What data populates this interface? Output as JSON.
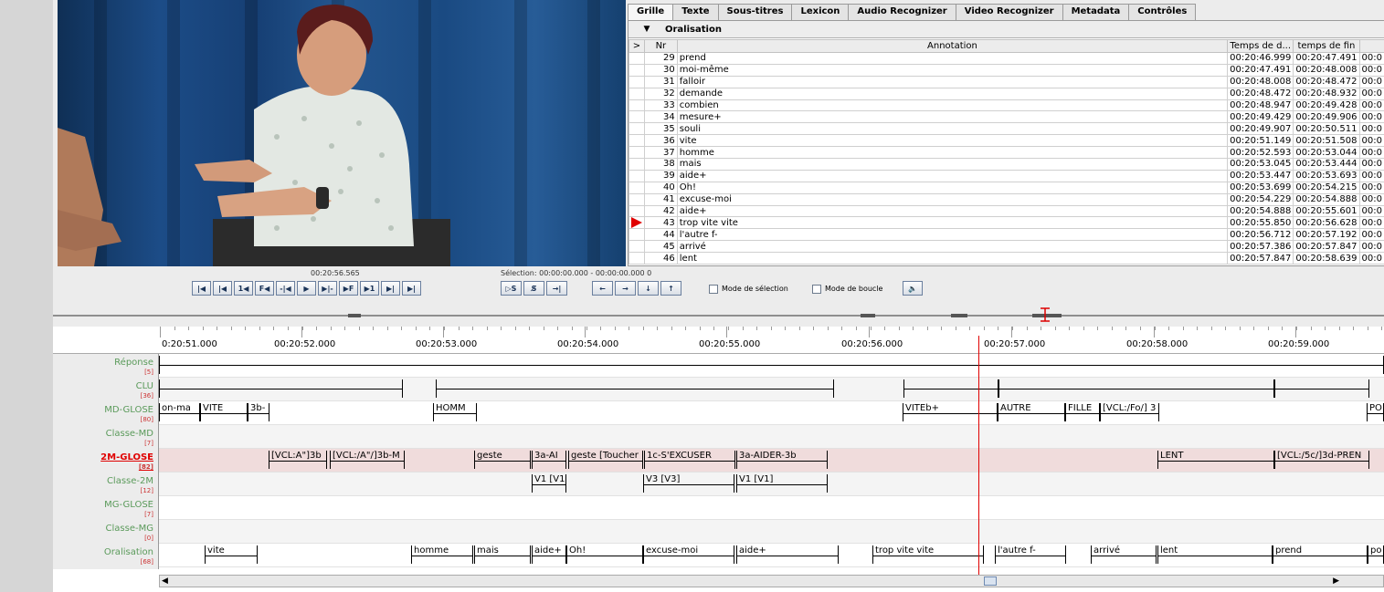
{
  "tabs": [
    "Grille",
    "Texte",
    "Sous-titres",
    "Lexicon",
    "Audio Recognizer",
    "Video Recognizer",
    "Metadata",
    "Contrôles"
  ],
  "grid": {
    "tier_dropdown": "▼",
    "tier_name": "Oralisation",
    "headers": {
      "mark": ">",
      "nr": "Nr",
      "annotation": "Annotation",
      "begin": "Temps de d...",
      "end": "temps de fin",
      "extra": ""
    },
    "rows": [
      {
        "nr": "29",
        "ann": "prend",
        "begin": "00:20:46.999",
        "end": "00:20:47.491",
        "extra": "00:0"
      },
      {
        "nr": "30",
        "ann": "moi-même",
        "begin": "00:20:47.491",
        "end": "00:20:48.008",
        "extra": "00:0"
      },
      {
        "nr": "31",
        "ann": "falloir",
        "begin": "00:20:48.008",
        "end": "00:20:48.472",
        "extra": "00:0"
      },
      {
        "nr": "32",
        "ann": "demande",
        "begin": "00:20:48.472",
        "end": "00:20:48.932",
        "extra": "00:0"
      },
      {
        "nr": "33",
        "ann": "combien",
        "begin": "00:20:48.947",
        "end": "00:20:49.428",
        "extra": "00:0"
      },
      {
        "nr": "34",
        "ann": "mesure+",
        "begin": "00:20:49.429",
        "end": "00:20:49.906",
        "extra": "00:0"
      },
      {
        "nr": "35",
        "ann": "souli",
        "begin": "00:20:49.907",
        "end": "00:20:50.511",
        "extra": "00:0"
      },
      {
        "nr": "36",
        "ann": "vite",
        "begin": "00:20:51.149",
        "end": "00:20:51.508",
        "extra": "00:0"
      },
      {
        "nr": "37",
        "ann": "homme",
        "begin": "00:20:52.593",
        "end": "00:20:53.044",
        "extra": "00:0"
      },
      {
        "nr": "38",
        "ann": "mais",
        "begin": "00:20:53.045",
        "end": "00:20:53.444",
        "extra": "00:0"
      },
      {
        "nr": "39",
        "ann": "aide+",
        "begin": "00:20:53.447",
        "end": "00:20:53.693",
        "extra": "00:0"
      },
      {
        "nr": "40",
        "ann": "Oh!",
        "begin": "00:20:53.699",
        "end": "00:20:54.215",
        "extra": "00:0"
      },
      {
        "nr": "41",
        "ann": "excuse-moi",
        "begin": "00:20:54.229",
        "end": "00:20:54.888",
        "extra": "00:0"
      },
      {
        "nr": "42",
        "ann": "aide+",
        "begin": "00:20:54.888",
        "end": "00:20:55.601",
        "extra": "00:0"
      },
      {
        "nr": "43",
        "ann": "trop vite vite",
        "begin": "00:20:55.850",
        "end": "00:20:56.628",
        "extra": "00:0"
      },
      {
        "nr": "44",
        "ann": "l'autre f-",
        "begin": "00:20:56.712",
        "end": "00:20:57.192",
        "extra": "00:0"
      },
      {
        "nr": "45",
        "ann": "arrivé",
        "begin": "00:20:57.386",
        "end": "00:20:57.847",
        "extra": "00:0"
      },
      {
        "nr": "46",
        "ann": "lent",
        "begin": "00:20:57.847",
        "end": "00:20:58.639",
        "extra": "00:0"
      }
    ],
    "current_row_index": 14
  },
  "player": {
    "current_time": "00:20:56.565",
    "selection": "Sélection: 00:00:00.000 - 00:00:00.000  0",
    "buttons": [
      "|◀",
      "|◀",
      "1◀",
      "F◀",
      "-|◀",
      "▶",
      "▶|-",
      "▶F",
      "▶1",
      "▶|",
      "▶|"
    ],
    "sel_buttons": [
      "▷S",
      "S̸",
      "→|"
    ],
    "nav_buttons": [
      "←",
      "→",
      "↓",
      "↑"
    ],
    "mode_selection": "Mode de sélection",
    "mode_boucle": "Mode de boucle",
    "volume_icon": "🔈"
  },
  "ruler": {
    "labels": [
      "0:20:51.000",
      "00:20:52.000",
      "00:20:53.000",
      "00:20:54.000",
      "00:20:55.000",
      "00:20:56.000",
      "00:20:57.000",
      "00:20:58.000",
      "00:20:59.000"
    ]
  },
  "tiers": [
    {
      "name": "Réponse",
      "count": "[5]",
      "active": false
    },
    {
      "name": "CLU",
      "count": "[36]",
      "active": false
    },
    {
      "name": "MD-GLOSE",
      "count": "[80]",
      "active": false
    },
    {
      "name": "Classe-MD",
      "count": "[7]",
      "active": false
    },
    {
      "name": "2M-GLOSE",
      "count": "[82]",
      "active": true
    },
    {
      "name": "Classe-2M",
      "count": "[12]",
      "active": false
    },
    {
      "name": "MG-GLOSE",
      "count": "[7]",
      "active": false
    },
    {
      "name": "Classe-MG",
      "count": "[0]",
      "active": false
    },
    {
      "name": "Oralisation",
      "count": "[68]",
      "active": false
    }
  ],
  "annotations": {
    "MD-GLOSE": [
      "on-ma",
      "VITE",
      "3b-",
      "HOMM",
      "VITEb+",
      "AUTRE",
      "FILLE",
      "[VCL:/Fo/] 3",
      "PO"
    ],
    "2M-GLOSE": [
      "[VCL:A\"]3b",
      "[VCL:/A\"/]3b-M",
      "geste",
      "3a-AI",
      "geste [Toucher",
      "1c-S'EXCUSER",
      "3a-AIDER-3b",
      "LENT",
      "[VCL:/5c/]3d-PREN"
    ],
    "Classe-2M": [
      "V1 [V1",
      "V3 [V3]",
      "V1 [V1]"
    ],
    "Oralisation": [
      "vite",
      "homme",
      "mais",
      "aide+",
      "Oh!",
      "excuse-moi",
      "aide+",
      "trop vite vite",
      "l'autre f-",
      "arrivé",
      "lent",
      "prend",
      "po"
    ]
  }
}
